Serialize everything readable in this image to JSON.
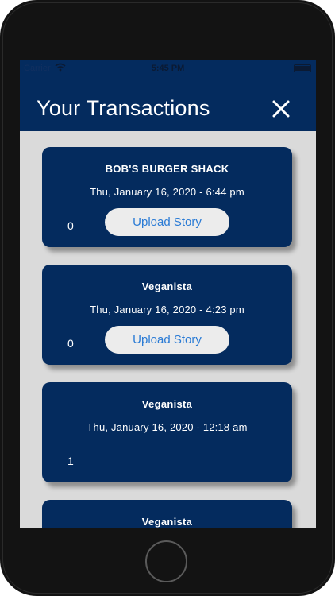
{
  "status_bar": {
    "carrier": "Carrier",
    "time": "5:45 PM",
    "icons": [
      "wifi-icon",
      "battery-icon"
    ]
  },
  "header": {
    "title": "Your Transactions",
    "close_icon": "close-icon"
  },
  "transactions": [
    {
      "merchant": "BOB'S BURGER SHACK",
      "datetime": "Thu, January 16, 2020 - 6:44 pm",
      "count": "0",
      "upload_label": "Upload Story"
    },
    {
      "merchant": "Veganista",
      "datetime": "Thu, January 16, 2020 - 4:23 pm",
      "count": "0",
      "upload_label": "Upload Story"
    },
    {
      "merchant": "Veganista",
      "datetime": "Thu, January 16, 2020 - 12:18 am",
      "count": "1"
    },
    {
      "merchant": "Veganista"
    }
  ],
  "colors": {
    "navy": "#042b5e",
    "background": "#dadada",
    "button_bg": "#ececec",
    "button_text": "#2a7bd5"
  }
}
